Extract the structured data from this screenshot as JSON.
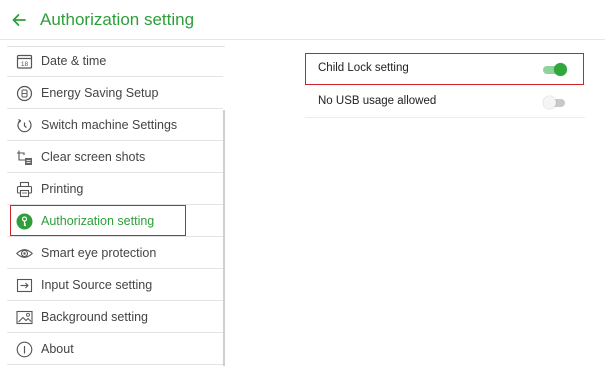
{
  "header": {
    "title": "Authorization setting",
    "back_icon": "back-arrow-icon",
    "accent_color": "#2e9e3b"
  },
  "sidebar": {
    "items": [
      {
        "label": "Date & time",
        "icon": "calendar-icon",
        "icon_text": "18"
      },
      {
        "label": "Energy Saving Setup",
        "icon": "energy-icon"
      },
      {
        "label": "Switch machine Settings",
        "icon": "power-cycle-icon"
      },
      {
        "label": "Clear screen shots",
        "icon": "crop-icon"
      },
      {
        "label": "Printing",
        "icon": "printer-icon"
      },
      {
        "label": "Authorization setting",
        "icon": "key-icon",
        "active": true
      },
      {
        "label": "Smart eye protection",
        "icon": "eye-icon"
      },
      {
        "label": "Input Source setting",
        "icon": "input-source-icon"
      },
      {
        "label": "Background setting",
        "icon": "image-icon"
      },
      {
        "label": "About",
        "icon": "info-icon"
      }
    ]
  },
  "settings": [
    {
      "label": "Child Lock setting",
      "enabled": true
    },
    {
      "label": "No USB usage allowed",
      "enabled": false
    }
  ],
  "colors": {
    "toggle_on": "#2ea83c",
    "toggle_off": "#c9c9c9",
    "highlight": "#d0202a"
  }
}
